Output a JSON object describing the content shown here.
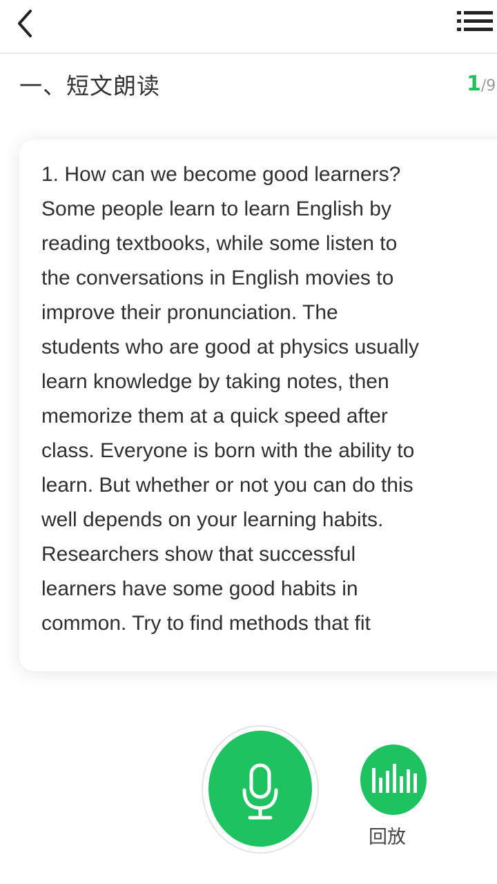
{
  "header": {
    "back_icon": "chevron-left-icon",
    "menu_icon": "list-menu-icon"
  },
  "section": {
    "title": "一、短文朗读",
    "current_page": "1",
    "total_pages": "/9"
  },
  "passage": {
    "lines": [
      "1. How can we become good learners?",
      "Some people learn to learn English by",
      "reading textbooks, while some listen to",
      "the conversations in English movies to",
      "improve their pronunciation. The",
      "students who are good at physics usually",
      "learn knowledge by taking notes, then",
      "memorize them at a quick speed after",
      "class. Everyone is born with the ability to",
      "learn. But whether or not you can do this",
      "well depends on your learning habits.",
      "Researchers show that successful",
      "learners have some good habits in",
      "common. Try to find methods that fit"
    ]
  },
  "controls": {
    "record_icon": "microphone-icon",
    "playback_icon": "audio-bars-icon",
    "playback_label": "回放"
  },
  "colors": {
    "accent": "#1ec261",
    "page_current": "#22c061"
  }
}
